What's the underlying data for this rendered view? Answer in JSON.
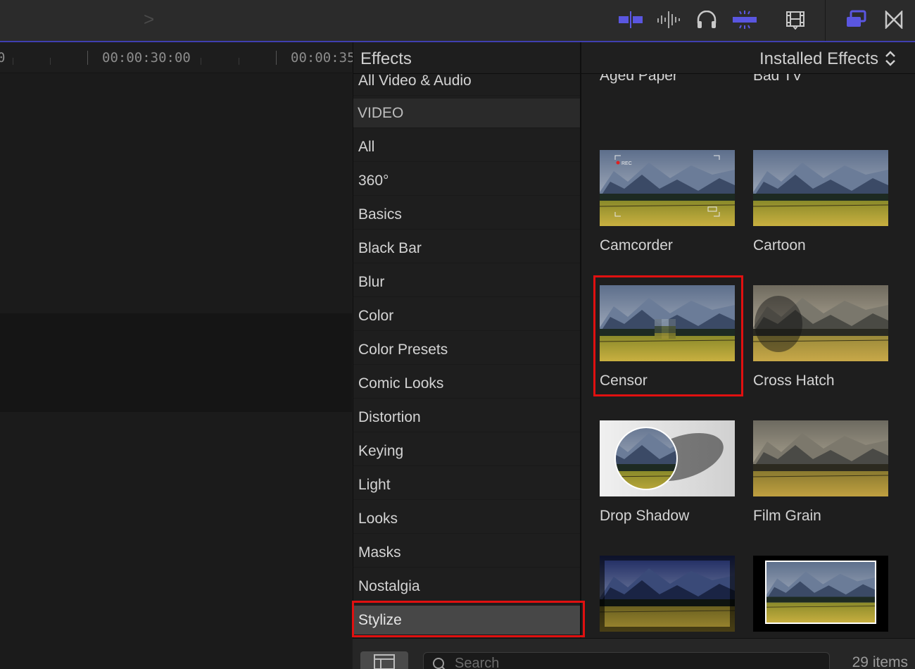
{
  "toolbar": {
    "nav_forward_glyph": ">",
    "icons": [
      "clip-skimming-icon",
      "audio-skimming-icon",
      "headphones-icon",
      "snapping-icon",
      "film-strip-icon",
      "effects-browser-icon",
      "transitions-browser-icon"
    ],
    "accent_color": "#5a56e0"
  },
  "timeline": {
    "timecodes": [
      "00:00:30:00",
      "00:00:35"
    ]
  },
  "sidebar": {
    "title": "Effects",
    "items": [
      {
        "label": "All Video & Audio",
        "kind": "item"
      },
      {
        "label": "VIDEO",
        "kind": "section"
      },
      {
        "label": "All",
        "kind": "item"
      },
      {
        "label": "360°",
        "kind": "item"
      },
      {
        "label": "Basics",
        "kind": "item"
      },
      {
        "label": "Black Bar",
        "kind": "item"
      },
      {
        "label": "Blur",
        "kind": "item"
      },
      {
        "label": "Color",
        "kind": "item"
      },
      {
        "label": "Color Presets",
        "kind": "item"
      },
      {
        "label": "Comic Looks",
        "kind": "item"
      },
      {
        "label": "Distortion",
        "kind": "item"
      },
      {
        "label": "Keying",
        "kind": "item"
      },
      {
        "label": "Light",
        "kind": "item"
      },
      {
        "label": "Looks",
        "kind": "item"
      },
      {
        "label": "Masks",
        "kind": "item"
      },
      {
        "label": "Nostalgia",
        "kind": "item"
      },
      {
        "label": "Stylize",
        "kind": "selected"
      }
    ]
  },
  "grid": {
    "title": "Installed Effects",
    "effects": [
      {
        "label": "Aged Paper",
        "style": "aged"
      },
      {
        "label": "Bad TV",
        "style": "normal"
      },
      {
        "label": "Camcorder",
        "style": "camcorder",
        "rec_text": "REC"
      },
      {
        "label": "Cartoon",
        "style": "normal"
      },
      {
        "label": "Censor",
        "style": "censor",
        "highlighted": true
      },
      {
        "label": "Cross Hatch",
        "style": "crosshatch"
      },
      {
        "label": "Drop Shadow",
        "style": "dropshadow"
      },
      {
        "label": "Film Grain",
        "style": "filmgrain"
      },
      {
        "label": "",
        "style": "vignette"
      },
      {
        "label": "",
        "style": "framed"
      }
    ]
  },
  "bottom": {
    "search_placeholder": "Search",
    "items_count": "29 items"
  },
  "highlight_color": "#e01010"
}
